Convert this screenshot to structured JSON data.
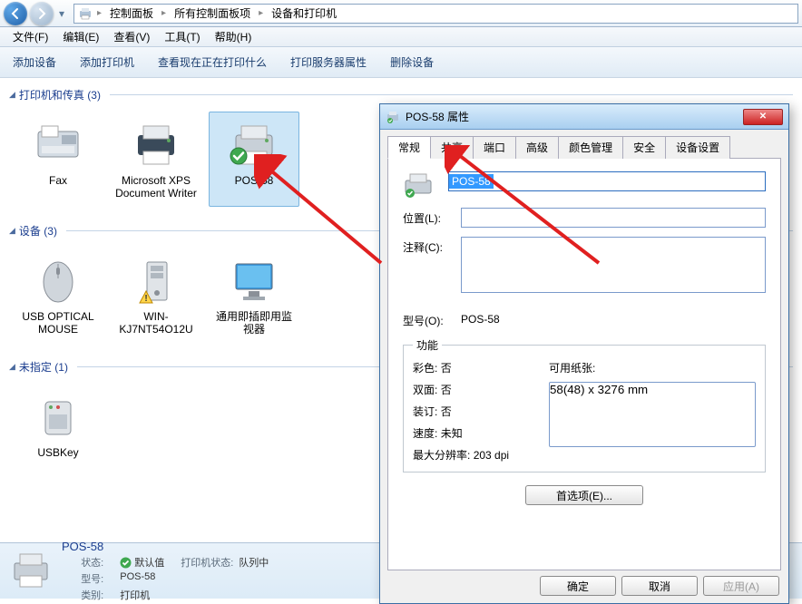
{
  "breadcrumb": {
    "items": [
      "控制面板",
      "所有控制面板项",
      "设备和打印机"
    ]
  },
  "menu": {
    "file": "文件(F)",
    "edit": "编辑(E)",
    "view": "查看(V)",
    "tools": "工具(T)",
    "help": "帮助(H)"
  },
  "toolbar": {
    "add_device": "添加设备",
    "add_printer": "添加打印机",
    "see_printing": "查看现在正在打印什么",
    "server_props": "打印服务器属性",
    "remove_device": "删除设备"
  },
  "sections": {
    "printers": {
      "title": "打印机和传真",
      "count": 3
    },
    "devices": {
      "title": "设备",
      "count": 3
    },
    "unspecified": {
      "title": "未指定",
      "count": 1
    }
  },
  "items": {
    "fax": "Fax",
    "xps": "Microsoft XPS Document Writer",
    "pos": "POS-58",
    "mouse": "USB OPTICAL MOUSE",
    "pc": "WIN-KJ7NT54O12U",
    "monitor": "通用即插即用监视器",
    "usbkey": "USBKey"
  },
  "details": {
    "name": "POS-58",
    "status_lbl": "状态:",
    "status_val": "默认值",
    "pstatus_lbl": "打印机状态:",
    "pstatus_val": "队列中",
    "model_lbl": "型号:",
    "model_val": "POS-58",
    "category_lbl": "类别:",
    "category_val": "打印机"
  },
  "dialog": {
    "title": "POS-58 属性",
    "tabs": {
      "general": "常规",
      "sharing": "共享",
      "ports": "端口",
      "advanced": "高级",
      "color": "颜色管理",
      "security": "安全",
      "device": "设备设置"
    },
    "name_value": "POS-58",
    "location_lbl": "位置(L):",
    "location_val": "",
    "comment_lbl": "注释(C):",
    "comment_val": "",
    "model_lbl": "型号(O):",
    "model_val": "POS-58",
    "features_legend": "功能",
    "features": {
      "color_lbl": "彩色:",
      "color_val": "否",
      "duplex_lbl": "双面:",
      "duplex_val": "否",
      "staple_lbl": "装订:",
      "staple_val": "否",
      "speed_lbl": "速度:",
      "speed_val": "未知",
      "res_lbl": "最大分辨率:",
      "res_val": "203 dpi",
      "paper_lbl": "可用纸张:",
      "paper_val": "58(48) x 3276 mm"
    },
    "preferences": "首选项(E)...",
    "ok": "确定",
    "cancel": "取消",
    "apply": "应用(A)"
  }
}
